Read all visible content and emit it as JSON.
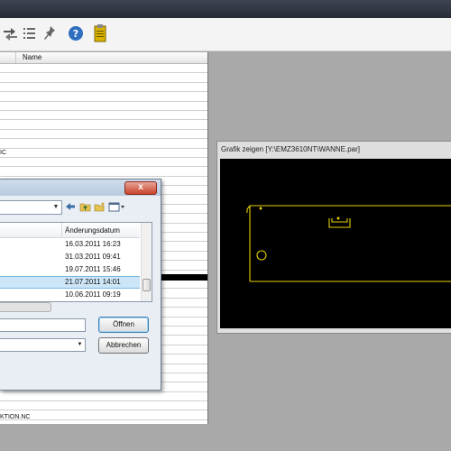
{
  "toolbar": {
    "icons": [
      "arrows-icon",
      "list-icon",
      "pin-icon",
      "help-icon",
      "clipboard-icon"
    ]
  },
  "file_list": {
    "column_name": "Name",
    "partial_entry_nc": "IC",
    "partial_entry_aktion": "KTION.NC"
  },
  "open_dialog": {
    "column_date": "Änderungsdatum",
    "dates": [
      "16.03.2011 16:23",
      "31.03.2011 09:41",
      "19.07.2011 15:46",
      "21.07.2011 14:01",
      "10.06.2011 09:19"
    ],
    "selected_index": 3,
    "open_button": "Öffnen",
    "cancel_button": "Abbrechen",
    "close_symbol": "x"
  },
  "graphic_window": {
    "title": "Grafik zeigen [Y:\\EMZ3610NT\\WANNE.par]",
    "outline_color": "#e8d000"
  }
}
